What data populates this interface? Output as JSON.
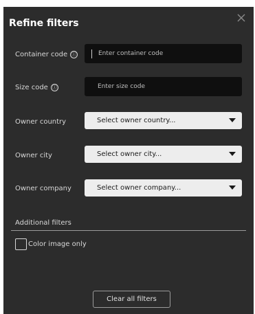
{
  "panel": {
    "title": "Refine filters",
    "close_icon": "close-icon"
  },
  "fields": {
    "container_code": {
      "label": "Container code",
      "info_icon": "ⓘ",
      "placeholder": "Enter container code"
    },
    "size_code": {
      "label": "Size code",
      "info_icon": "ⓘ",
      "placeholder": "Enter size code"
    },
    "owner_country": {
      "label": "Owner country",
      "value": "Select owner country..."
    },
    "owner_city": {
      "label": "Owner city",
      "value": "Select owner city..."
    },
    "owner_company": {
      "label": "Owner company",
      "value": "Select owner company..."
    }
  },
  "additional": {
    "section_label": "Additional filters",
    "color_image_only": "Color image only"
  },
  "footer": {
    "clear_label": "Clear all filters"
  },
  "colors": {
    "panel_bg": "#2c2c2c",
    "input_bg": "#0f0f0f",
    "select_bg": "#ededed",
    "text": "#d8d8d8"
  }
}
